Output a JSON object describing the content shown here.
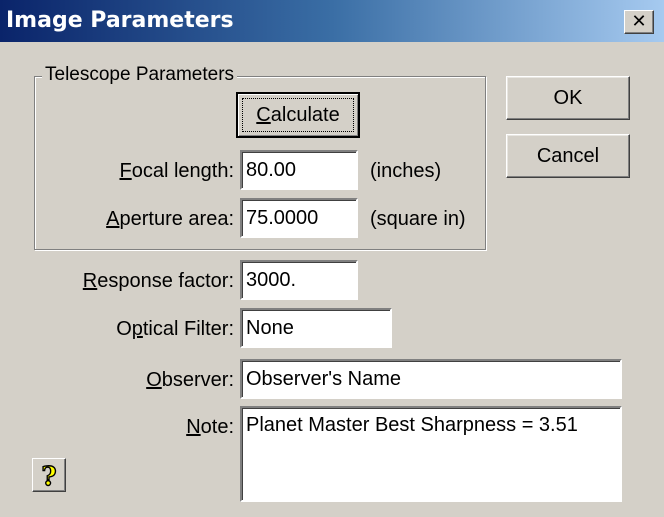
{
  "window": {
    "title": "Image Parameters",
    "close_glyph": "✕"
  },
  "telescope_group": {
    "legend": "Telescope Parameters",
    "calculate_button": {
      "mnemonic": "C",
      "rest": "alculate"
    },
    "focal_length": {
      "mnemonic": "F",
      "rest": "ocal length:",
      "value": "80.00",
      "unit": "(inches)"
    },
    "aperture_area": {
      "mnemonic": "A",
      "rest": "perture area:",
      "value": "75.0000",
      "unit": "(square in)"
    }
  },
  "response_factor": {
    "mnemonic": "R",
    "rest": "esponse factor:",
    "value": "3000."
  },
  "optical_filter": {
    "pre": "O",
    "mnemonic": "p",
    "rest": "tical Filter:",
    "value": "None"
  },
  "observer": {
    "mnemonic": "O",
    "rest": "bserver:",
    "value": "Observer's Name"
  },
  "note": {
    "mnemonic": "N",
    "rest": "ote:",
    "value": "Planet Master Best Sharpness = 3.51"
  },
  "buttons": {
    "ok": "OK",
    "cancel": "Cancel"
  },
  "icons": {
    "help": "help-question-icon",
    "close": "close-icon"
  },
  "colors": {
    "titlebar_start": "#0a246a",
    "titlebar_end": "#a6caf0",
    "face": "#d4d0c8",
    "help_yellow": "#ffff00"
  }
}
